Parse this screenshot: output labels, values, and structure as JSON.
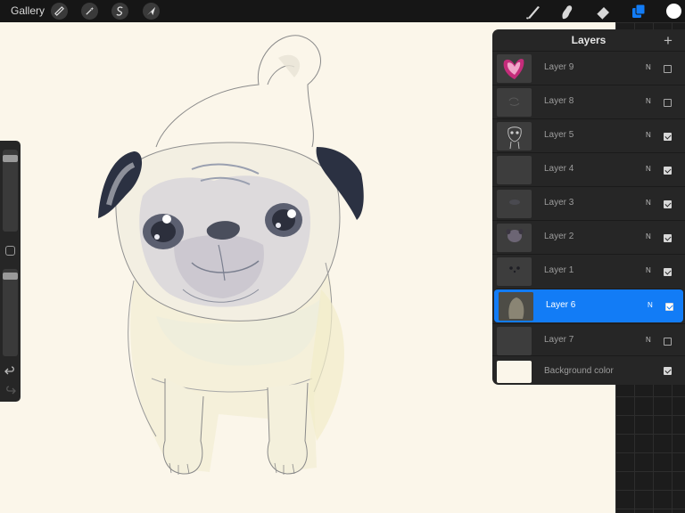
{
  "toolbar": {
    "gallery_label": "Gallery",
    "left_tools": [
      "wrench-icon",
      "magic-wand-icon",
      "selection-s-icon",
      "arrow-cursor-icon"
    ],
    "right_tools": [
      "brush-icon",
      "smudge-icon",
      "eraser-icon",
      "layers-icon"
    ],
    "active_right_tool": "layers-icon",
    "active_color": "#ffffff",
    "accent": "#127cf6"
  },
  "sidebar": {
    "brush_size_level": 0.05,
    "opacity_level": 0.05,
    "icons": [
      "modify-square-icon",
      "undo-icon",
      "redo-icon"
    ]
  },
  "layers_panel": {
    "title": "Layers",
    "add_label": "+",
    "layers": [
      {
        "name": "Layer 9",
        "blend": "N",
        "visible": false,
        "selected": false,
        "thumb": "pink-heart"
      },
      {
        "name": "Layer 8",
        "blend": "N",
        "visible": false,
        "selected": false,
        "thumb": "faint-sketch"
      },
      {
        "name": "Layer 5",
        "blend": "N",
        "visible": true,
        "selected": false,
        "thumb": "pug-lineart"
      },
      {
        "name": "Layer 4",
        "blend": "N",
        "visible": true,
        "selected": false,
        "thumb": "blank"
      },
      {
        "name": "Layer 3",
        "blend": "N",
        "visible": true,
        "selected": false,
        "thumb": "blank"
      },
      {
        "name": "Layer 2",
        "blend": "N",
        "visible": true,
        "selected": false,
        "thumb": "face-shade"
      },
      {
        "name": "Layer 1",
        "blend": "N",
        "visible": true,
        "selected": false,
        "thumb": "eyes"
      },
      {
        "name": "Layer 6",
        "blend": "N",
        "visible": true,
        "selected": true,
        "thumb": "pug-body"
      },
      {
        "name": "Layer 7",
        "blend": "N",
        "visible": false,
        "selected": false,
        "thumb": "blank"
      },
      {
        "name": "Background color",
        "blend": "",
        "visible": true,
        "selected": false,
        "thumb": "cream"
      }
    ]
  },
  "colors": {
    "canvas": "#fbf6ea",
    "panel": "#262626",
    "toolbar": "#161616",
    "selected_layer": "#127cf6"
  }
}
